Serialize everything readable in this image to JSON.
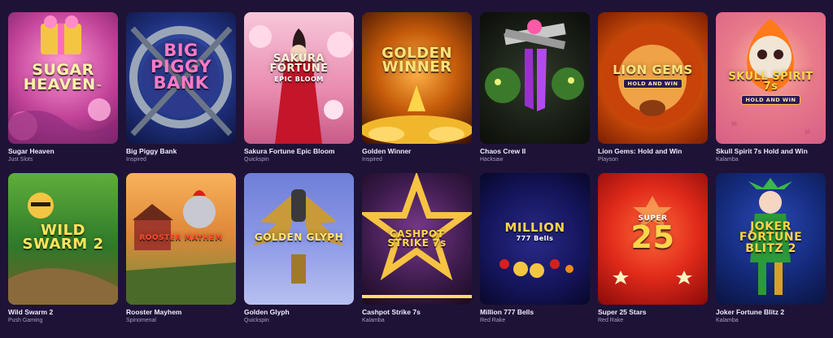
{
  "games": [
    {
      "title": "Sugar Heaven",
      "provider": "Just Slots",
      "logo": "SUGAR HEAVEN",
      "logo_extra": "™",
      "badge": ""
    },
    {
      "title": "Big Piggy Bank",
      "provider": "Inspired",
      "logo": "BIG PIGGY BANK",
      "logo_extra": "",
      "badge": ""
    },
    {
      "title": "Sakura Fortune Epic Bloom",
      "provider": "Quickspin",
      "logo": "SAKURA FORTUNE",
      "logo_extra": "EPIC BLOOM",
      "badge": ""
    },
    {
      "title": "Golden Winner",
      "provider": "Inspired",
      "logo": "GOLDEN WINNER",
      "logo_extra": "",
      "badge": ""
    },
    {
      "title": "Chaos Crew II",
      "provider": "Hacksaw",
      "logo": "",
      "logo_extra": "",
      "badge": ""
    },
    {
      "title": "Lion Gems: Hold and Win",
      "provider": "Playson",
      "logo": "LION GEMS",
      "logo_extra": "",
      "badge": "HOLD AND WIN"
    },
    {
      "title": "Skull Spirit 7s Hold and Win",
      "provider": "Kalamba",
      "logo": "SKULL SPIRIT 7s",
      "logo_extra": "",
      "badge": "HOLD AND WIN"
    },
    {
      "title": "Wild Swarm 2",
      "provider": "Push Gaming",
      "logo": "WILD SWARM 2",
      "logo_extra": "",
      "badge": ""
    },
    {
      "title": "Rooster Mayhem",
      "provider": "Spinomenal",
      "logo": "ROOSTER MAYHEM",
      "logo_extra": "",
      "badge": ""
    },
    {
      "title": "Golden Glyph",
      "provider": "Quickspin",
      "logo": "GOLDEN GLYPH",
      "logo_extra": "",
      "badge": ""
    },
    {
      "title": "Cashpot Strike 7s",
      "provider": "Kalamba",
      "logo": "CASHPOT STRIKE 7s",
      "logo_extra": "",
      "badge": ""
    },
    {
      "title": "Million 777 Bells",
      "provider": "Red Rake",
      "logo": "MILLION",
      "logo_extra": "777 Bells",
      "badge": ""
    },
    {
      "title": "Super 25 Stars",
      "provider": "Red Rake",
      "logo": "25",
      "logo_extra": "SUPER",
      "badge": ""
    },
    {
      "title": "Joker Fortune Blitz 2",
      "provider": "Kalamba",
      "logo": "JOKER FORTUNE BLITZ 2",
      "logo_extra": "",
      "badge": ""
    }
  ],
  "colors": {
    "page_bg": "#1e1336",
    "title": "#f1ecff",
    "provider": "#a89dc4"
  }
}
